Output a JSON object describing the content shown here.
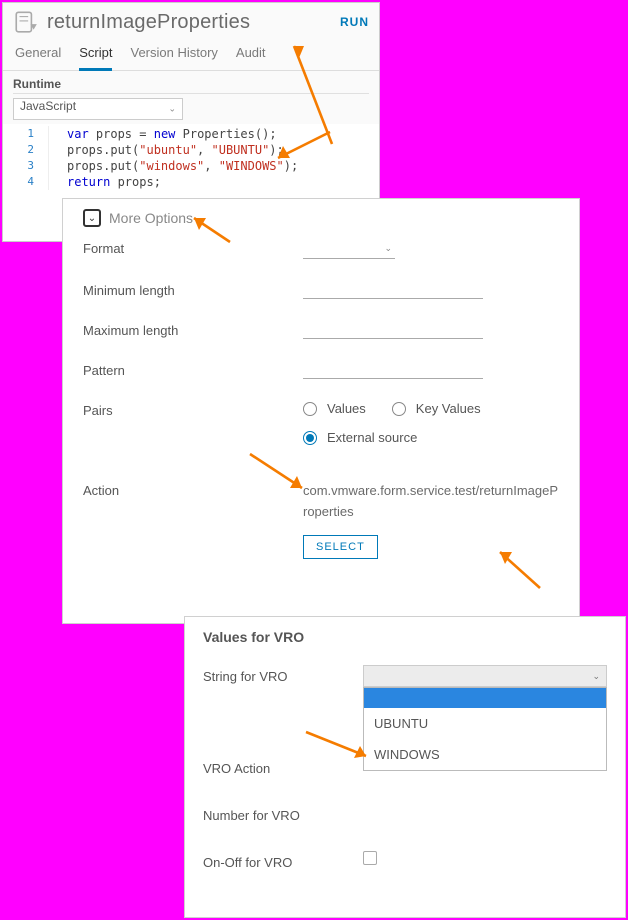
{
  "editor": {
    "title": "returnImageProperties",
    "run": "RUN",
    "tabs": [
      "General",
      "Script",
      "Version History",
      "Audit"
    ],
    "active_tab": 1,
    "runtime_label": "Runtime",
    "runtime_value": "JavaScript",
    "code_lines": [
      {
        "n": "1",
        "html": "<span class='kw'>var</span> props = <span class='kw'>new</span> Properties();"
      },
      {
        "n": "2",
        "html": "props.put(<span class='str'>\"ubuntu\"</span>, <span class='str'>\"UBUNTU\"</span>);"
      },
      {
        "n": "3",
        "html": "props.put(<span class='str'>\"windows\"</span>, <span class='str'>\"WINDOWS\"</span>);"
      },
      {
        "n": "4",
        "html": "<span class='kw'>return</span> props;"
      }
    ]
  },
  "options": {
    "more_options": "More Options",
    "format": "Format",
    "minlen": "Minimum length",
    "maxlen": "Maximum length",
    "pattern": "Pattern",
    "pairs": "Pairs",
    "pairs_values": "Values",
    "pairs_keyvalues": "Key Values",
    "pairs_external": "External source",
    "action": "Action",
    "action_path": "com.vmware.form.service.test/returnImageProperties",
    "select": "SELECT"
  },
  "vro": {
    "title": "Values for VRO",
    "string_label": "String for VRO",
    "action_label": "VRO Action",
    "dropdown": [
      "UBUNTU",
      "WINDOWS"
    ],
    "number_label": "Number for VRO",
    "onoff_label": "On-Off for VRO"
  }
}
